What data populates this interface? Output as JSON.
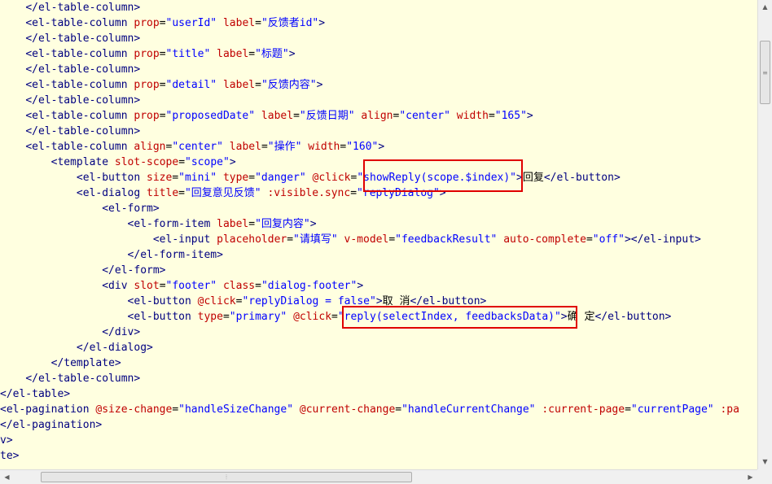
{
  "editor": {
    "background": "#ffffe0",
    "colors": {
      "tag": "#000080",
      "attribute": "#c00000",
      "value": "#0000ff",
      "text": "#000000",
      "highlight_box": "#e00000"
    },
    "lines": [
      [
        [
          "tx",
          "    "
        ],
        [
          "tg",
          "</el-table-column>"
        ]
      ],
      [
        [
          "tx",
          "    "
        ],
        [
          "tg",
          "<el-table-column "
        ],
        [
          "at",
          "prop"
        ],
        [
          "tx",
          "="
        ],
        [
          "vl",
          "\"userId\""
        ],
        [
          "tx",
          " "
        ],
        [
          "at",
          "label"
        ],
        [
          "tx",
          "="
        ],
        [
          "vl",
          "\"反馈者id\""
        ],
        [
          "tg",
          ">"
        ]
      ],
      [
        [
          "tx",
          "    "
        ],
        [
          "tg",
          "</el-table-column>"
        ]
      ],
      [
        [
          "tx",
          "    "
        ],
        [
          "tg",
          "<el-table-column "
        ],
        [
          "at",
          "prop"
        ],
        [
          "tx",
          "="
        ],
        [
          "vl",
          "\"title\""
        ],
        [
          "tx",
          " "
        ],
        [
          "at",
          "label"
        ],
        [
          "tx",
          "="
        ],
        [
          "vl",
          "\"标题\""
        ],
        [
          "tg",
          ">"
        ]
      ],
      [
        [
          "tx",
          "    "
        ],
        [
          "tg",
          "</el-table-column>"
        ]
      ],
      [
        [
          "tx",
          "    "
        ],
        [
          "tg",
          "<el-table-column "
        ],
        [
          "at",
          "prop"
        ],
        [
          "tx",
          "="
        ],
        [
          "vl",
          "\"detail\""
        ],
        [
          "tx",
          " "
        ],
        [
          "at",
          "label"
        ],
        [
          "tx",
          "="
        ],
        [
          "vl",
          "\"反馈内容\""
        ],
        [
          "tg",
          ">"
        ]
      ],
      [
        [
          "tx",
          "    "
        ],
        [
          "tg",
          "</el-table-column>"
        ]
      ],
      [
        [
          "tx",
          "    "
        ],
        [
          "tg",
          "<el-table-column "
        ],
        [
          "at",
          "prop"
        ],
        [
          "tx",
          "="
        ],
        [
          "vl",
          "\"proposedDate\""
        ],
        [
          "tx",
          " "
        ],
        [
          "at",
          "label"
        ],
        [
          "tx",
          "="
        ],
        [
          "vl",
          "\"反馈日期\""
        ],
        [
          "tx",
          " "
        ],
        [
          "at",
          "align"
        ],
        [
          "tx",
          "="
        ],
        [
          "vl",
          "\"center\""
        ],
        [
          "tx",
          " "
        ],
        [
          "at",
          "width"
        ],
        [
          "tx",
          "="
        ],
        [
          "vl",
          "\"165\""
        ],
        [
          "tg",
          ">"
        ]
      ],
      [
        [
          "tx",
          "    "
        ],
        [
          "tg",
          "</el-table-column>"
        ]
      ],
      [
        [
          "tx",
          "    "
        ],
        [
          "tg",
          "<el-table-column "
        ],
        [
          "at",
          "align"
        ],
        [
          "tx",
          "="
        ],
        [
          "vl",
          "\"center\""
        ],
        [
          "tx",
          " "
        ],
        [
          "at",
          "label"
        ],
        [
          "tx",
          "="
        ],
        [
          "vl",
          "\"操作\""
        ],
        [
          "tx",
          " "
        ],
        [
          "at",
          "width"
        ],
        [
          "tx",
          "="
        ],
        [
          "vl",
          "\"160\""
        ],
        [
          "tg",
          ">"
        ]
      ],
      [
        [
          "tx",
          "        "
        ],
        [
          "tg",
          "<template "
        ],
        [
          "at",
          "slot-scope"
        ],
        [
          "tx",
          "="
        ],
        [
          "vl",
          "\"scope\""
        ],
        [
          "tg",
          ">"
        ]
      ],
      [
        [
          "tx",
          "            "
        ],
        [
          "tg",
          "<el-button "
        ],
        [
          "at",
          "size"
        ],
        [
          "tx",
          "="
        ],
        [
          "vl",
          "\"mini\""
        ],
        [
          "tx",
          " "
        ],
        [
          "at",
          "type"
        ],
        [
          "tx",
          "="
        ],
        [
          "vl",
          "\"danger\""
        ],
        [
          "tx",
          " "
        ],
        [
          "at",
          "@click"
        ],
        [
          "tx",
          "="
        ],
        [
          "vl",
          "\"showReply(scope.$index)\""
        ],
        [
          "tg",
          ">"
        ],
        [
          "tx",
          "回复"
        ],
        [
          "tg",
          "</el-button>"
        ]
      ],
      [
        [
          "tx",
          "            "
        ],
        [
          "tg",
          "<el-dialog "
        ],
        [
          "at",
          "title"
        ],
        [
          "tx",
          "="
        ],
        [
          "vl",
          "\"回复意见反馈\""
        ],
        [
          "tx",
          " "
        ],
        [
          "at",
          ":visible.sync"
        ],
        [
          "tx",
          "="
        ],
        [
          "vl",
          "\"replyDialog\""
        ],
        [
          "tg",
          ">"
        ]
      ],
      [
        [
          "tx",
          "                "
        ],
        [
          "tg",
          "<el-form>"
        ]
      ],
      [
        [
          "tx",
          "                    "
        ],
        [
          "tg",
          "<el-form-item "
        ],
        [
          "at",
          "label"
        ],
        [
          "tx",
          "="
        ],
        [
          "vl",
          "\"回复内容\""
        ],
        [
          "tg",
          ">"
        ]
      ],
      [
        [
          "tx",
          "                        "
        ],
        [
          "tg",
          "<el-input "
        ],
        [
          "at",
          "placeholder"
        ],
        [
          "tx",
          "="
        ],
        [
          "vl",
          "\"请填写\""
        ],
        [
          "tx",
          " "
        ],
        [
          "at",
          "v-model"
        ],
        [
          "tx",
          "="
        ],
        [
          "vl",
          "\"feedbackResult\""
        ],
        [
          "tx",
          " "
        ],
        [
          "at",
          "auto-complete"
        ],
        [
          "tx",
          "="
        ],
        [
          "vl",
          "\"off\""
        ],
        [
          "tg",
          ">"
        ],
        [
          "tg",
          "</el-input>"
        ]
      ],
      [
        [
          "tx",
          "                    "
        ],
        [
          "tg",
          "</el-form-item>"
        ]
      ],
      [
        [
          "tx",
          "                "
        ],
        [
          "tg",
          "</el-form>"
        ]
      ],
      [
        [
          "tx",
          "                "
        ],
        [
          "tg",
          "<div "
        ],
        [
          "at",
          "slot"
        ],
        [
          "tx",
          "="
        ],
        [
          "vl",
          "\"footer\""
        ],
        [
          "tx",
          " "
        ],
        [
          "at",
          "class"
        ],
        [
          "tx",
          "="
        ],
        [
          "vl",
          "\"dialog-footer\""
        ],
        [
          "tg",
          ">"
        ]
      ],
      [
        [
          "tx",
          "                    "
        ],
        [
          "tg",
          "<el-button "
        ],
        [
          "at",
          "@click"
        ],
        [
          "tx",
          "="
        ],
        [
          "vl",
          "\"replyDialog = false\""
        ],
        [
          "tg",
          ">"
        ],
        [
          "tx",
          "取 消"
        ],
        [
          "tg",
          "</el-button>"
        ]
      ],
      [
        [
          "tx",
          "                    "
        ],
        [
          "tg",
          "<el-button "
        ],
        [
          "at",
          "type"
        ],
        [
          "tx",
          "="
        ],
        [
          "vl",
          "\"primary\""
        ],
        [
          "tx",
          " "
        ],
        [
          "at",
          "@click"
        ],
        [
          "tx",
          "="
        ],
        [
          "vl",
          "\"reply(selectIndex, feedbacksData)\""
        ],
        [
          "tg",
          ">"
        ],
        [
          "tx",
          "确 定"
        ],
        [
          "tg",
          "</el-button>"
        ]
      ],
      [
        [
          "tx",
          "                "
        ],
        [
          "tg",
          "</div>"
        ]
      ],
      [
        [
          "tx",
          "            "
        ],
        [
          "tg",
          "</el-dialog>"
        ]
      ],
      [
        [
          "tx",
          "        "
        ],
        [
          "tg",
          "</template>"
        ]
      ],
      [
        [
          "tx",
          "    "
        ],
        [
          "tg",
          "</el-table-column>"
        ]
      ],
      [
        [
          "tg",
          "</el-table>"
        ]
      ],
      [
        [
          "tg",
          "<el-pagination "
        ],
        [
          "at",
          "@size-change"
        ],
        [
          "tx",
          "="
        ],
        [
          "vl",
          "\"handleSizeChange\""
        ],
        [
          "tx",
          " "
        ],
        [
          "at",
          "@current-change"
        ],
        [
          "tx",
          "="
        ],
        [
          "vl",
          "\"handleCurrentChange\""
        ],
        [
          "tx",
          " "
        ],
        [
          "at",
          ":current-page"
        ],
        [
          "tx",
          "="
        ],
        [
          "vl",
          "\"currentPage\""
        ],
        [
          "tx",
          " "
        ],
        [
          "at",
          ":pa"
        ]
      ],
      [
        [
          "tg",
          "</el-pagination>"
        ]
      ],
      [
        [
          "tg",
          "v>"
        ]
      ],
      [
        [
          "tg",
          "te>"
        ]
      ]
    ]
  },
  "scrollbars": {
    "vertical": {
      "up_icon": "triangle-up",
      "down_icon": "triangle-down"
    },
    "horizontal": {
      "left_icon": "triangle-left",
      "right_icon": "triangle-right"
    }
  }
}
